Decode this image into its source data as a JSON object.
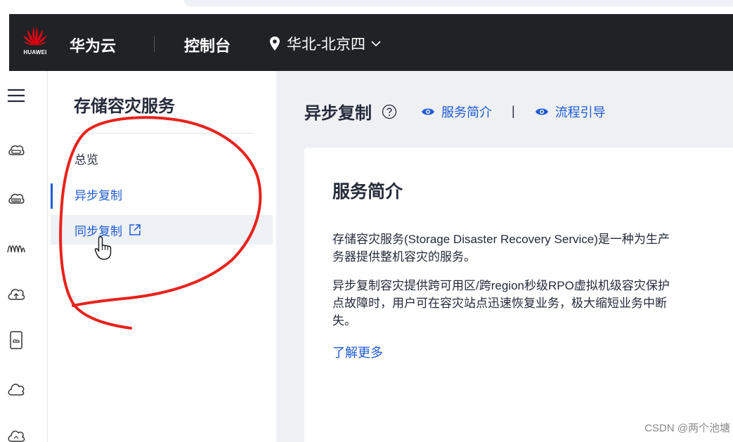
{
  "header": {
    "logo_text": "HUAWEI",
    "brand": "华为云",
    "console": "控制台",
    "region": "华北-北京四"
  },
  "sidebar": {
    "title": "存储容灾服务",
    "items": [
      {
        "label": "总览"
      },
      {
        "label": "异步复制"
      },
      {
        "label": "同步复制"
      }
    ]
  },
  "main": {
    "page_title": "异步复制",
    "links": [
      "服务简介",
      "流程引导"
    ],
    "separator": "|",
    "card": {
      "title": "服务简介",
      "paragraph1": [
        "存储容灾服务(Storage Disaster Recovery Service)是一种为生产",
        "务器提供整机容灾的服务。"
      ],
      "paragraph2": [
        "异步复制容灾提供跨可用区/跨region秒级RPO虚拟机级容灾保护",
        "点故障时，用户可在容灾站点迅速恢复业务，极大缩短业务中断",
        "失。"
      ],
      "learn_more": "了解更多"
    }
  },
  "watermark": "CSDN @两个池塘",
  "colors": {
    "topbar": "#212225",
    "accent": "#1f5bd6",
    "content_bg": "#eef0f4",
    "annotation": "#e8221c"
  },
  "icons": {
    "rail": [
      "menu-icon",
      "cloud-server-icon",
      "cloud-disk-icon",
      "wave-icon",
      "cloud-upload-icon",
      "device-icon",
      "cloud-icon",
      "cloud-sync-icon"
    ]
  }
}
